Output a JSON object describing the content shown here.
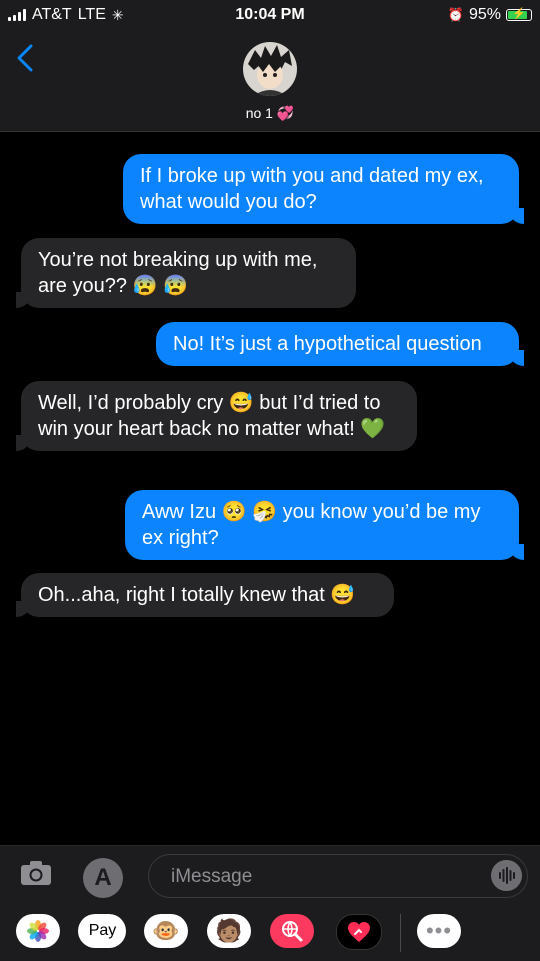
{
  "status": {
    "carrier": "AT&T",
    "network": "LTE",
    "time": "10:04 PM",
    "battery": "95%",
    "battery_level": 0.95
  },
  "header": {
    "contact_name": "no 1 💞"
  },
  "messages": [
    {
      "from": "me",
      "text": "If I broke up with you and dated my ex, what would you do?"
    },
    {
      "from": "them",
      "text": "You’re not breaking up with me, are you?? 😰 😰"
    },
    {
      "from": "me",
      "text": "No! It’s just a hypothetical question"
    },
    {
      "from": "them",
      "text": "Well, I’d probably cry 😅 but I’d tried to win your heart back no matter what! 💚"
    },
    {
      "from": "me",
      "text": "Aww Izu 🥺 🤧 you know you’d be my ex right?"
    },
    {
      "from": "them",
      "text": "Oh...aha, right I totally knew that 😅"
    }
  ],
  "input": {
    "placeholder": "iMessage"
  },
  "apps": {
    "pay_label": "Pay"
  },
  "colors": {
    "outgoing": "#0b84fe",
    "incoming": "#262628",
    "accent": "#0a84ff"
  }
}
